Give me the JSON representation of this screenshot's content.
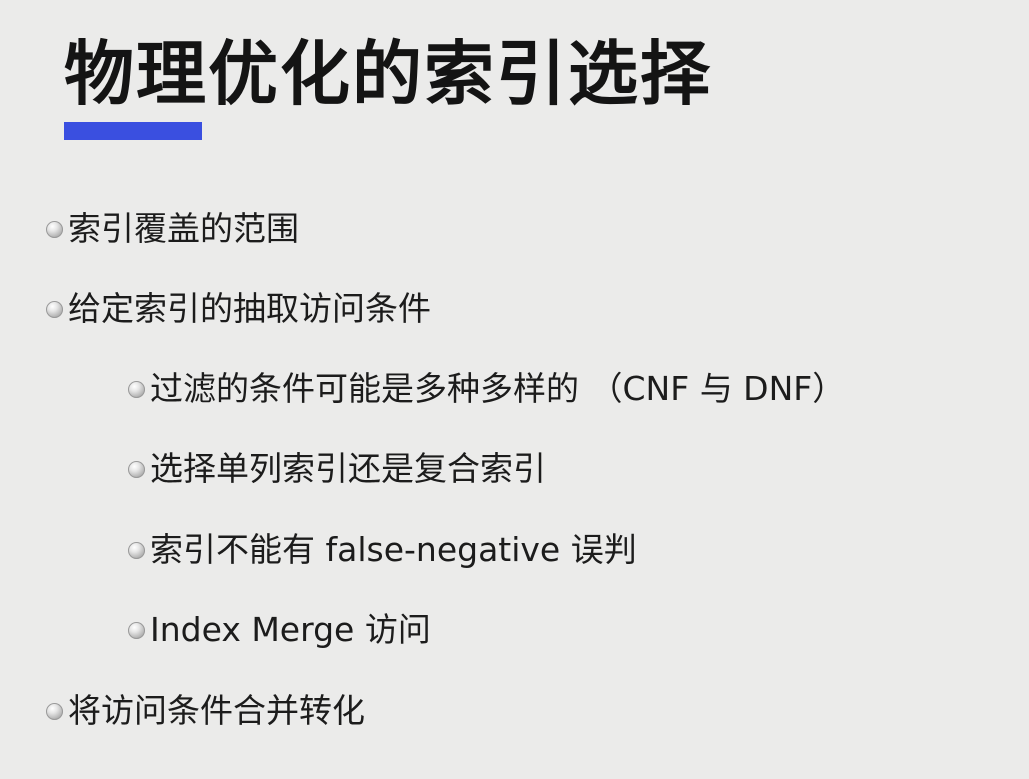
{
  "slide": {
    "title": "物理优化的索引选择",
    "accent_color": "#3a4fe0",
    "bullets": [
      {
        "level": 1,
        "text": "索引覆盖的范围"
      },
      {
        "level": 1,
        "text": "给定索引的抽取访问条件"
      },
      {
        "level": 2,
        "text": "过滤的条件可能是多种多样的 （CNF 与 DNF）"
      },
      {
        "level": 2,
        "text": "选择单列索引还是复合索引"
      },
      {
        "level": 2,
        "text": "索引不能有 false-negative 误判"
      },
      {
        "level": 2,
        "text": "Index Merge 访问"
      },
      {
        "level": 1,
        "text": "将访问条件合并转化"
      }
    ]
  }
}
